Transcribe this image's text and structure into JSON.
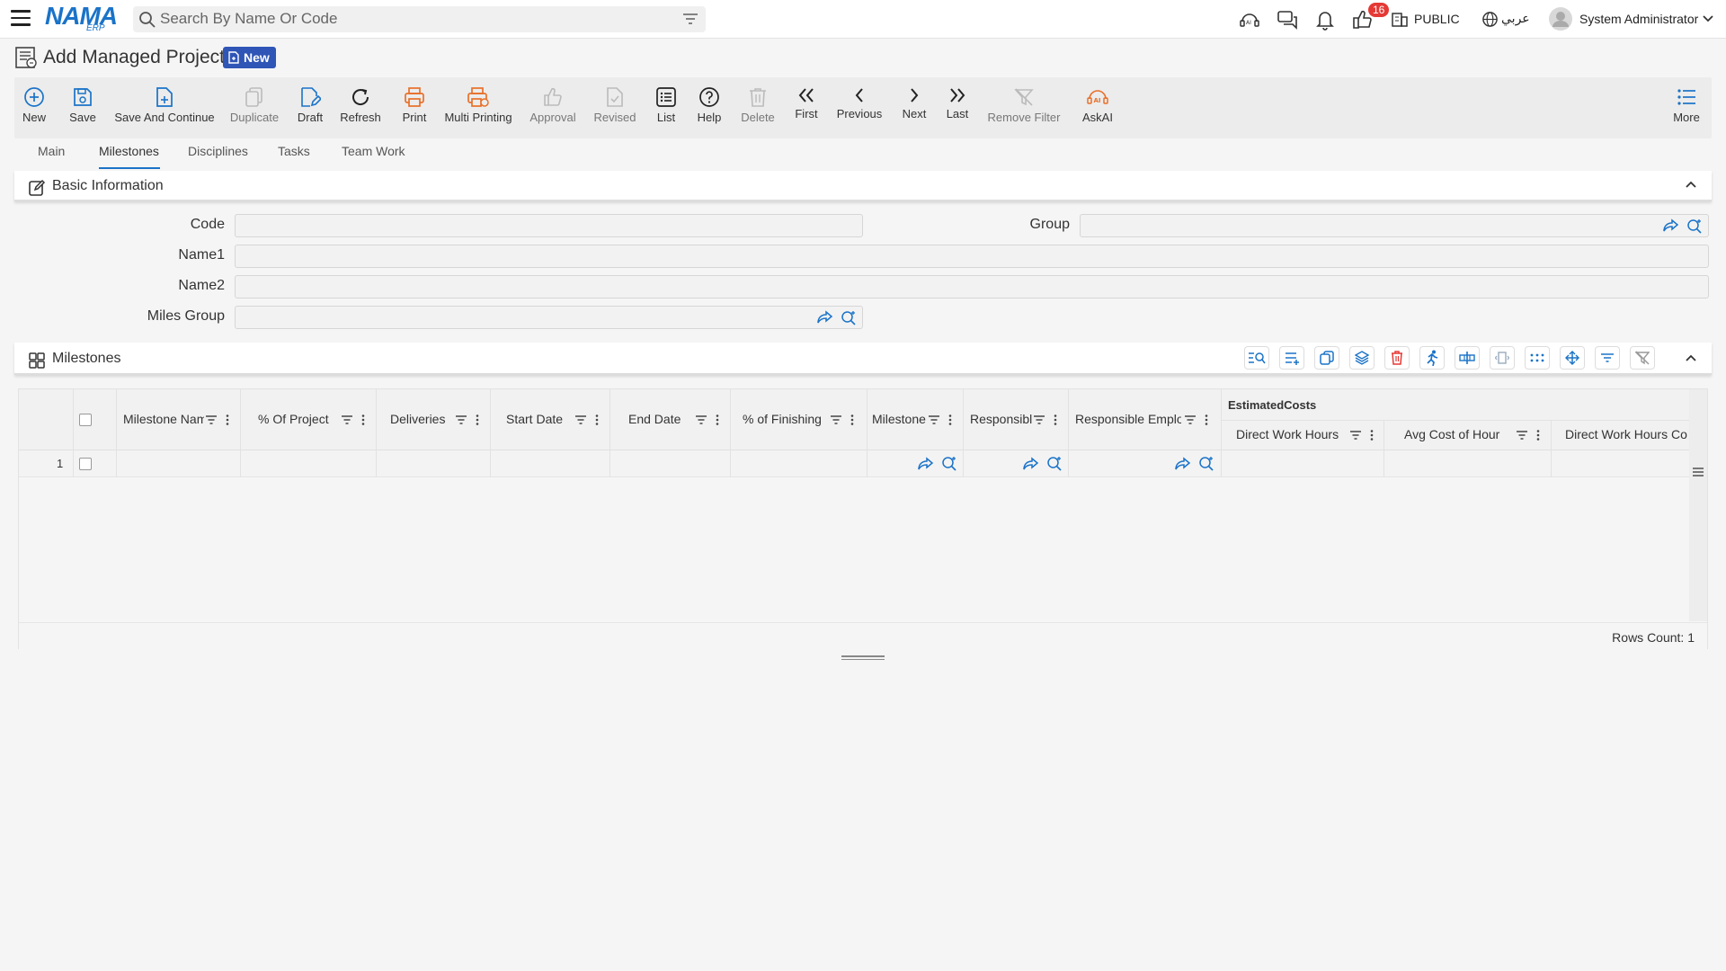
{
  "header": {
    "logo_main": "NAMA",
    "logo_sub": "ERP",
    "search_placeholder": "Search By Name Or Code",
    "notification_count": "16",
    "public_label": "PUBLIC",
    "language_label": "عربي",
    "user_name": "System Administrator"
  },
  "page": {
    "title": "Add Managed Project",
    "status_badge": "New"
  },
  "toolbar": {
    "new": "New",
    "save": "Save",
    "save_continue": "Save And Continue",
    "duplicate": "Duplicate",
    "draft": "Draft",
    "refresh": "Refresh",
    "print": "Print",
    "multi_printing": "Multi Printing",
    "approval": "Approval",
    "revised": "Revised",
    "list": "List",
    "help": "Help",
    "delete": "Delete",
    "first": "First",
    "previous": "Previous",
    "next": "Next",
    "last": "Last",
    "remove_filter": "Remove Filter",
    "askai": "AskAI",
    "more": "More"
  },
  "tabs": [
    "Main",
    "Milestones",
    "Disciplines",
    "Tasks",
    "Team Work"
  ],
  "basic_info": {
    "title": "Basic Information",
    "code_label": "Code",
    "code_value": "",
    "group_label": "Group",
    "group_value": "",
    "name1_label": "Name1",
    "name1_value": "",
    "name2_label": "Name2",
    "name2_value": "",
    "miles_group_label": "Miles Group",
    "miles_group_value": ""
  },
  "milestones": {
    "title": "Milestones",
    "group_header": "EstimatedCosts",
    "columns": [
      "Milestone Nam",
      "% Of Project",
      "Deliveries",
      "Start Date",
      "End Date",
      "% of Finishing",
      "Milestone",
      "Responsibl",
      "Responsible Emplo",
      "Direct Work Hours",
      "Avg Cost of Hour",
      "Direct Work Hours Co"
    ],
    "rows": [
      {
        "index": "1"
      }
    ],
    "rows_count": "Rows Count: 1"
  },
  "colors": {
    "accent": "#1a73c8",
    "orange": "#e8702a",
    "badge": "#2f55b6",
    "danger": "#e53935"
  }
}
